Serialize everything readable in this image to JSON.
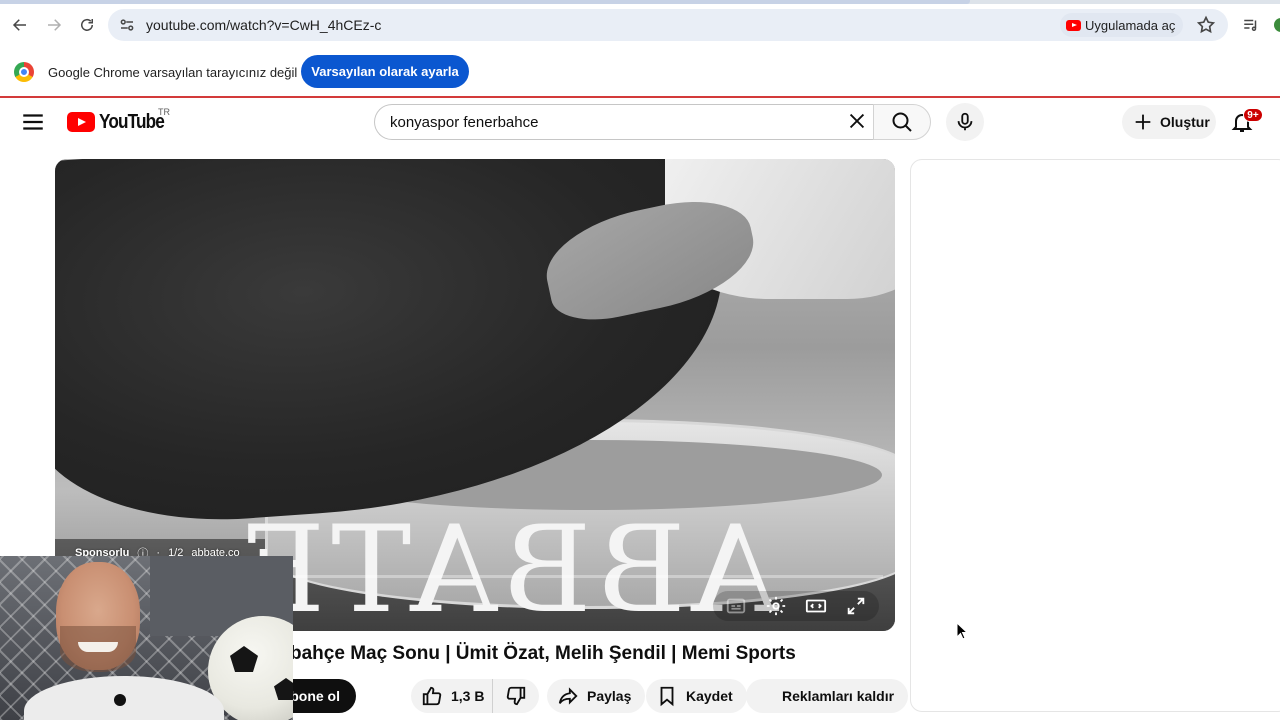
{
  "browser": {
    "url": "youtube.com/watch?v=CwH_4hCEz-c",
    "open_in_app": "Uygulamada aç",
    "banner_text": "Google Chrome varsayılan tarayıcınız değil",
    "banner_button": "Varsayılan olarak ayarla"
  },
  "masthead": {
    "logo_text": "YouTube",
    "country_code": "TR",
    "search_query": "konyaspor fenerbahce",
    "create_label": "Oluştur",
    "notification_count": "9+"
  },
  "player": {
    "ad_brand_text": "ABBATE",
    "sponsored_label": "Sponsorlu",
    "ad_counter": "1/2",
    "ad_domain": "abbate.co",
    "progress_fraction": 0.0
  },
  "video": {
    "title_visible": "bahçe Maç Sonu | Ümit Özat, Melih Şendil | Memi Sports",
    "subscribe_label": "Abone ol",
    "like_count": "1,3 B",
    "share_label": "Paylaş",
    "save_label": "Kaydet",
    "remove_ads_label": "Reklamları kaldır"
  },
  "icons": [
    "back-icon",
    "forward-icon",
    "reload-icon",
    "site-info-icon",
    "star-icon",
    "media-control-icon",
    "chrome-logo-icon",
    "menu-icon",
    "youtube-logo-icon",
    "clear-icon",
    "search-icon",
    "microphone-icon",
    "plus-icon",
    "bell-icon",
    "captions-icon",
    "settings-icon",
    "theater-icon",
    "fullscreen-icon",
    "like-icon",
    "dislike-icon",
    "share-icon",
    "bookmark-icon"
  ],
  "colors": {
    "youtube_red": "#ff0000",
    "chrome_blue_button": "#0b57d0",
    "subscribe_black": "#0f0f0f",
    "pill_gray": "#f2f2f2"
  }
}
